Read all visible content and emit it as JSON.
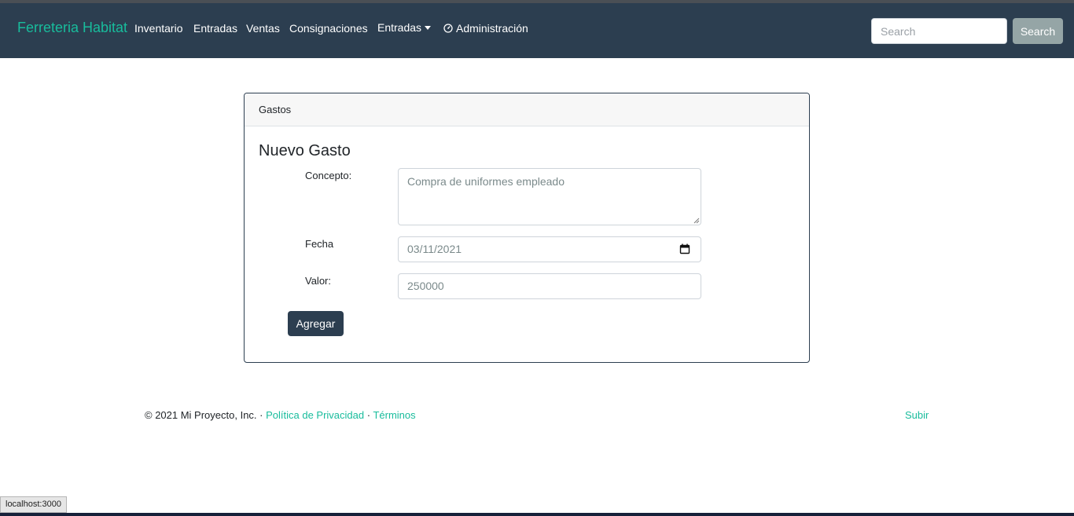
{
  "navbar": {
    "brand": "Ferreteria Habitat",
    "links": [
      "Inventario",
      "Entradas",
      "Ventas",
      "Consignaciones"
    ],
    "dropdown_label": "Entradas",
    "admin_label": "Administración",
    "admin_icon": "dashboard-icon",
    "search_placeholder": "Search",
    "search_button": "Search"
  },
  "card": {
    "header": "Gastos",
    "title": "Nuevo Gasto",
    "fields": {
      "concepto_label": "Concepto:",
      "concepto_value": "Compra de uniformes empleado",
      "fecha_label": "Fecha",
      "fecha_value": "03/11/2021",
      "valor_label": "Valor:",
      "valor_value": "250000"
    },
    "submit": "Agregar"
  },
  "footer": {
    "copyright": "© 2021 Mi Proyecto, Inc. · ",
    "privacy": "Política de Privacidad",
    "separator": " · ",
    "terms": "Términos",
    "back_to_top": "Subir"
  },
  "status_bar": {
    "url": "localhost:3000"
  },
  "colors": {
    "primary": "#2c3e50",
    "accent": "#18bc9c",
    "secondary": "#95a5a6"
  }
}
